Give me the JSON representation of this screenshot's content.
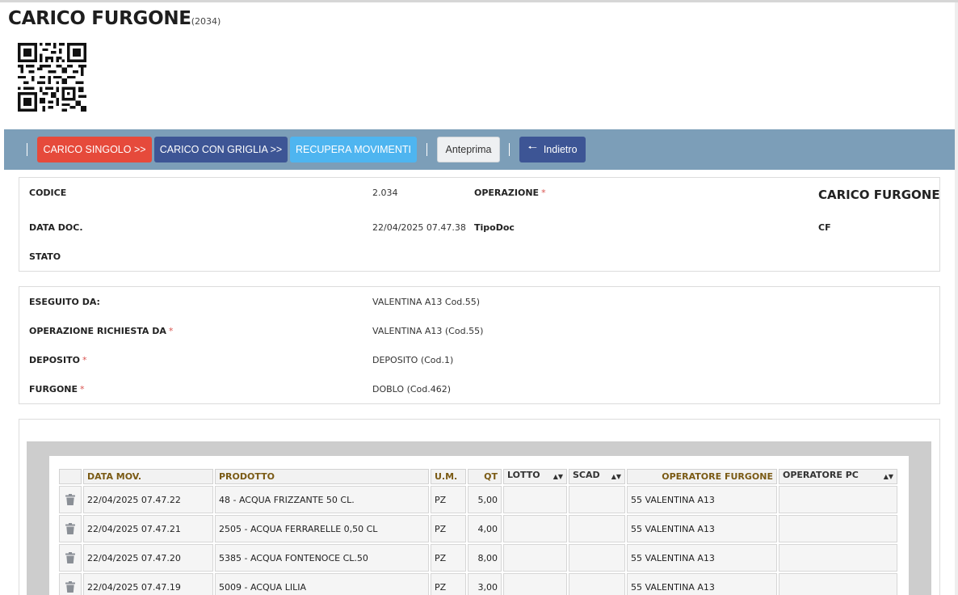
{
  "page": {
    "title": "CARICO FURGONE",
    "title_code": "(2034)"
  },
  "toolbar": {
    "buttons": [
      {
        "label": "CARICO SINGOLO >>",
        "color": "#e64a3b"
      },
      {
        "label": "CARICO CON GRIGLIA >>",
        "color": "#3d5595"
      },
      {
        "label": "RECUPERA MOVIMENTI",
        "color": "#4eb5f0"
      },
      {
        "label": "Anteprima",
        "color": "#eef0f2"
      },
      {
        "label": "Indietro",
        "icon": "arrow-left-icon",
        "color": "#3d5595"
      }
    ]
  },
  "document": {
    "codice_label": "CODICE",
    "codice_value": "2.034",
    "operazione_label": "OPERAZIONE",
    "operazione_value": "CARICO FURGONE",
    "data_label": "DATA DOC.",
    "data_value": "22/04/2025 07.47.38",
    "tipodoc_label": "TipoDoc",
    "tipodoc_value": "CF",
    "stato_label": "STATO"
  },
  "details": {
    "eseguito_label": "ESEGUITO DA:",
    "eseguito_value": "VALENTINA A13 Cod.55)",
    "richiesta_label": "OPERAZIONE RICHIESTA DA",
    "richiesta_value": "VALENTINA A13 (Cod.55)",
    "deposito_label": "DEPOSITO",
    "deposito_value": "DEPOSITO (Cod.1)",
    "furgone_label": "FURGONE",
    "furgone_value": "DOBLO (Cod.462)",
    "required_mark": "*"
  },
  "grid": {
    "columns": [
      "DATA MOV.",
      "PRODOTTO",
      "U.M.",
      "QT",
      "LOTTO",
      "SCAD",
      "OPERATORE FURGONE",
      "OPERATORE PC"
    ],
    "rows": [
      {
        "data": "22/04/2025 07.47.22",
        "prodotto": "48 - ACQUA FRIZZANTE 50 CL.",
        "um": "PZ",
        "qt": "5,00",
        "lotto": "",
        "scad": "",
        "op_furgone": "55 VALENTINA A13",
        "op_pc": ""
      },
      {
        "data": "22/04/2025 07.47.21",
        "prodotto": "2505 - ACQUA FERRARELLE 0,50 CL",
        "um": "PZ",
        "qt": "4,00",
        "lotto": "",
        "scad": "",
        "op_furgone": "55 VALENTINA A13",
        "op_pc": ""
      },
      {
        "data": "22/04/2025 07.47.20",
        "prodotto": "5385 - ACQUA FONTENOCE CL.50",
        "um": "PZ",
        "qt": "8,00",
        "lotto": "",
        "scad": "",
        "op_furgone": "55 VALENTINA A13",
        "op_pc": ""
      },
      {
        "data": "22/04/2025 07.47.19",
        "prodotto": "5009 - ACQUA LILIA",
        "um": "PZ",
        "qt": "3,00",
        "lotto": "",
        "scad": "",
        "op_furgone": "55 VALENTINA A13",
        "op_pc": ""
      }
    ]
  },
  "colors": {
    "toolbar_bg": "#7c9eb8",
    "header_text": "#7a5a14",
    "required": "#d9534f"
  }
}
